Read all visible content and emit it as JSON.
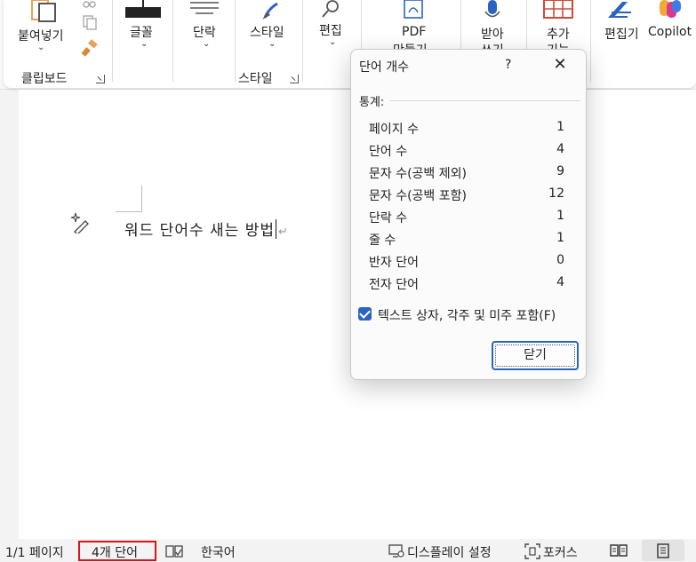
{
  "ribbon": {
    "paste_label": "붙여넣기",
    "clipboard_group": "클립보드",
    "font_label": "글꼴",
    "paragraph_label": "단락",
    "styles_label": "스타일",
    "styles_group": "스타일",
    "editing_label": "편집",
    "pdf_label_1": "PDF",
    "pdf_label_2": "만들기",
    "dictate_label_1": "받아",
    "dictate_label_2": "쓰기",
    "addins_label_1": "추가",
    "addins_label_2": "기능",
    "editor_label": "편집기",
    "copilot_label": "Copilot"
  },
  "document": {
    "text": "워드 단어수 새는 방법"
  },
  "dialog": {
    "title": "단어 개수",
    "help": "?",
    "close_glyph": "✕",
    "stats_label": "통계:",
    "rows": [
      {
        "label": "페이지 수",
        "value": "1"
      },
      {
        "label": "단어 수",
        "value": "4"
      },
      {
        "label": "문자 수(공백 제외)",
        "value": "9"
      },
      {
        "label": "문자 수(공백 포함)",
        "value": "12"
      },
      {
        "label": "단락 수",
        "value": "1"
      },
      {
        "label": "줄 수",
        "value": "1"
      },
      {
        "label": "반자 단어",
        "value": "0"
      },
      {
        "label": "전자 단어",
        "value": "4"
      }
    ],
    "checkbox_label": "텍스트 상자, 각주 및 미주 포함(F)",
    "checkbox_checked": true,
    "close_button": "닫기"
  },
  "status": {
    "page": "1/1 페이지",
    "words": "4개 단어",
    "language": "한국어",
    "display_settings": "디스플레이 설정",
    "focus": "포커스"
  },
  "colors": {
    "accent": "#2b63c1",
    "highlight_box": "#e0101a",
    "copilot": [
      "#f4a83a",
      "#d73a8c",
      "#3c7be6"
    ]
  }
}
